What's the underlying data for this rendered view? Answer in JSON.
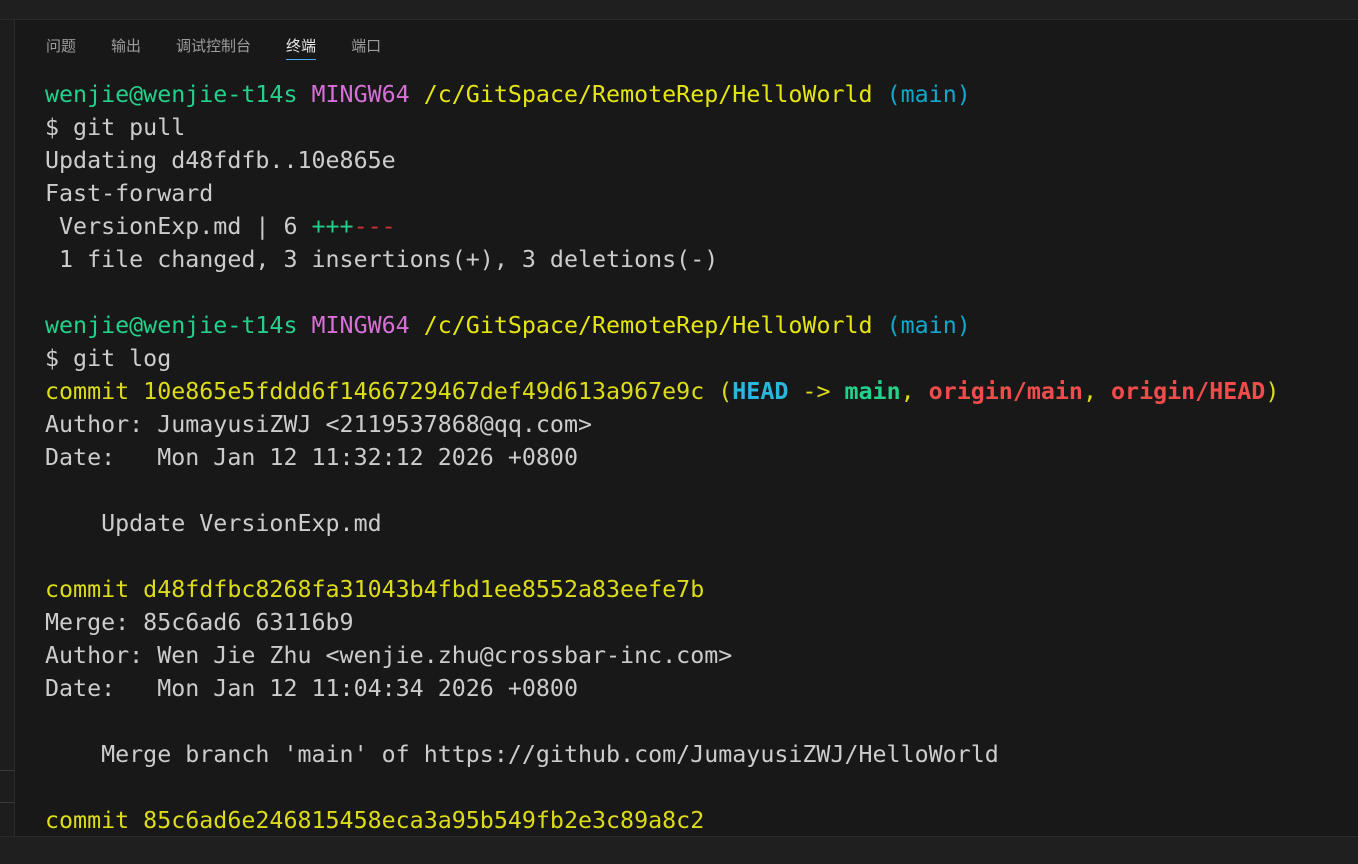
{
  "panel": {
    "tabs": [
      {
        "label": "问题"
      },
      {
        "label": "输出"
      },
      {
        "label": "调试控制台"
      },
      {
        "label": "终端",
        "active": true
      },
      {
        "label": "端口"
      }
    ]
  },
  "terminal": {
    "prompt1": {
      "user": "wenjie@wenjie-t14s",
      "shell": "MINGW64",
      "path": "/c/GitSpace/RemoteRep/HelloWorld",
      "branch": "(main)"
    },
    "cmd1": "$ git pull",
    "pull_output": {
      "updating": "Updating d48fdfb..10e865e",
      "fast_forward": "Fast-forward",
      "stat_file": " VersionExp.md | 6 ",
      "stat_plus": "+++",
      "stat_minus": "---",
      "summary": " 1 file changed, 3 insertions(+), 3 deletions(-)"
    },
    "prompt2": {
      "user": "wenjie@wenjie-t14s",
      "shell": "MINGW64",
      "path": "/c/GitSpace/RemoteRep/HelloWorld",
      "branch": "(main)"
    },
    "cmd2": "$ git log",
    "commit1": {
      "commit_line": "commit 10e865e5fddd6f1466729467def49d613a967e9c",
      "open_paren": " (",
      "head": "HEAD",
      "arrow": " -> ",
      "main": "main",
      "comma1": ", ",
      "origin_main": "origin/main",
      "comma2": ", ",
      "origin_head": "origin/HEAD",
      "close_paren": ")",
      "author": "Author: JumayusiZWJ <2119537868@qq.com>",
      "date": "Date:   Mon Jan 12 11:32:12 2026 +0800",
      "message": "    Update VersionExp.md"
    },
    "commit2": {
      "commit_line": "commit d48fdfbc8268fa31043b4fbd1ee8552a83eefe7b",
      "merge": "Merge: 85c6ad6 63116b9",
      "author": "Author: Wen Jie Zhu <wenjie.zhu@crossbar-inc.com>",
      "date": "Date:   Mon Jan 12 11:04:34 2026 +0800",
      "message": "    Merge branch 'main' of https://github.com/JumayusiZWJ/HelloWorld"
    },
    "commit3": {
      "commit_line": "commit 85c6ad6e246815458eca3a95b549fb2e3c89a8c2"
    }
  },
  "colors": {
    "background": "#181818",
    "prompt_user": "#23d18b",
    "prompt_shell": "#d670d6",
    "prompt_path": "#e5e510",
    "prompt_branch": "#11a8cd",
    "commit_hash": "#e5e510",
    "ref_head": "#29b8db",
    "ref_branch": "#23d18b",
    "ref_remote": "#f14c4c",
    "active_tab_underline": "#4daafc"
  }
}
